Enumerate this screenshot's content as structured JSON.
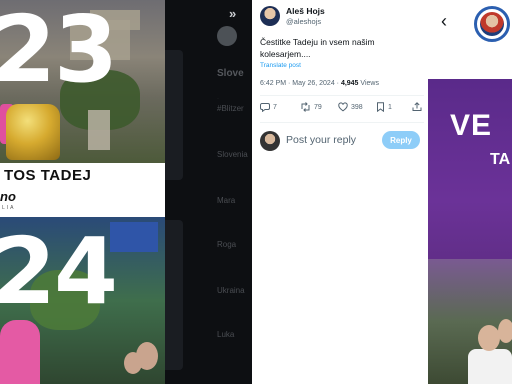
{
  "poster": {
    "year_top": "23",
    "year_bottom": "24",
    "name_line": "TOS TADEJ",
    "brand": "no",
    "brand_sub": "LIA"
  },
  "middle": {
    "expand_icon": "»",
    "heading": "Slove",
    "faint_items": [
      "#Blitzer",
      "Slovenia",
      "Mara",
      "Roga",
      "Ukraina",
      "Luka"
    ]
  },
  "tweet": {
    "author_name": "Aleš Hojs",
    "author_handle": "@aleshojs",
    "text": "Čestitke Tadeju in vsem našim kolesarjem....",
    "translate_label": "Translate post",
    "time": "6:42 PM · May 26, 2024 · ",
    "views_count": "4,945",
    "views_label": " Views",
    "replies": "7",
    "reposts": "79",
    "likes": "398",
    "bookmarks": "1",
    "reply_placeholder": "Post your reply",
    "reply_button": "Reply"
  },
  "right": {
    "back_icon": "‹",
    "banner_big": "VE",
    "banner_sub": "TA"
  },
  "colors": {
    "accent": "#1d9bf0",
    "reply_button_bg": "#8ecdf8",
    "banner_purple": "#6b3298"
  }
}
